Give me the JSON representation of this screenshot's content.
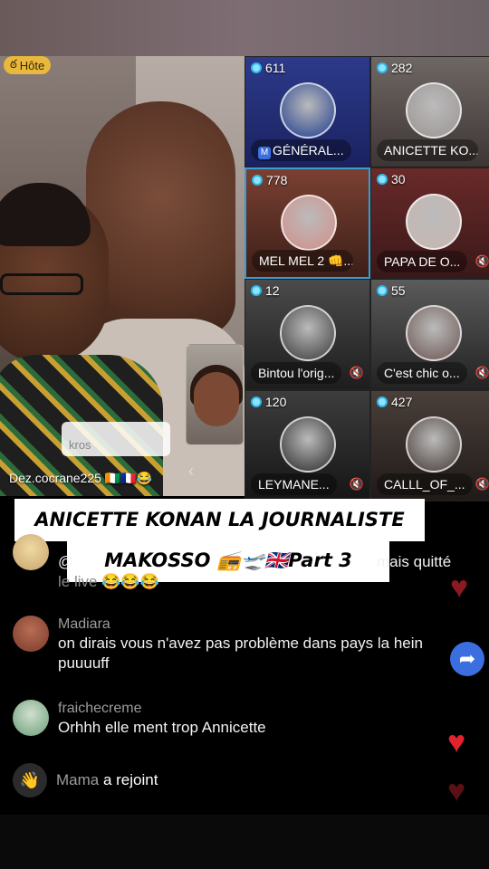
{
  "host": {
    "badge_label": "Hôte",
    "name": "Dez.cocrane225 🇨🇮🇫🇷😂",
    "pill_text": "kros"
  },
  "guests": [
    {
      "count": "611",
      "label": "GÉNÉRAL...",
      "badge": "M",
      "muted": false,
      "selected": false
    },
    {
      "count": "282",
      "label": "ANICETTE KO...",
      "muted": false,
      "selected": false
    },
    {
      "count": "778",
      "label": "MEL MEL 2 👊...",
      "muted": false,
      "selected": true
    },
    {
      "count": "30",
      "label": "PAPA DE O...",
      "muted": true,
      "selected": false
    },
    {
      "count": "12",
      "label": "Bintou l'orig...",
      "muted": true,
      "selected": false
    },
    {
      "count": "55",
      "label": "C'est chic o...",
      "muted": true,
      "selected": false
    },
    {
      "count": "120",
      "label": "LEYMANE...",
      "muted": true,
      "selected": false
    },
    {
      "count": "427",
      "label": "CALLL_OF_...",
      "muted": true,
      "selected": false
    }
  ],
  "caption": {
    "line1": "ANICETTE KONAN LA JOURNALISTE &",
    "line2": "MAKOSSO 📻🛫🇬🇧Part 3"
  },
  "comments": [
    {
      "user": "",
      "text_partial_left": "@",
      "text_partial_right": "mais quitté",
      "line2": "le live 😂😂😂"
    },
    {
      "user": "Madiara",
      "text": "on dirais vous n'avez pas problème dans pays la hein puuuuff"
    },
    {
      "user": "fraichecreme",
      "text": "Orhhh elle ment trop Annicette"
    }
  ],
  "join": {
    "user": "Mama",
    "text": "a rejoint"
  },
  "icons": {
    "share": "share-arrow-icon",
    "heart": "heart-icon",
    "mute": "mic-off-icon",
    "wave": "wave-hand-icon"
  },
  "colors": {
    "accent_blue": "#3b6fe0",
    "heart_red": "#e0232f",
    "host_badge": "#e8b93c",
    "selected_border": "#3a9bd5"
  }
}
